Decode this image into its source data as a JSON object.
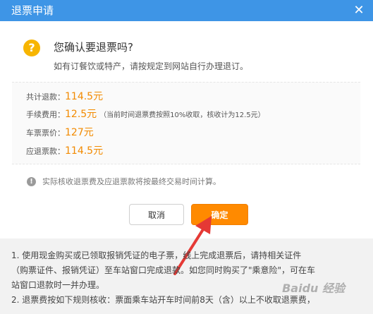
{
  "dialog": {
    "title": "退票申请",
    "close_symbol": "✕",
    "question_symbol": "?",
    "confirm_title": "您确认要退票吗?",
    "confirm_subtitle": "如有订餐饮或特产，请按规定到网站自行办理退订。",
    "summary": {
      "total_label": "共计退款：",
      "total_value": "114.5元",
      "fee_label": "手续费用：",
      "fee_value": "12.5元",
      "fee_note": "（当前时间退票费按照10%收取，核收计为12.5元）",
      "price_label": "车票票价：",
      "price_value": "127元",
      "refund_label": "应退票款：",
      "refund_value": "114.5元"
    },
    "notice_symbol": "!",
    "notice_text": "实际核收退票费及应退票款将按最终交易时间计算。",
    "cancel_label": "取消",
    "confirm_label": "确定"
  },
  "rules": {
    "line1": "1. 使用现金购买或已领取报销凭证的电子票，线上完成退票后，请持相关证件",
    "line2": "（购票证件、报销凭证）至车站窗口完成退款。如您同时购买了\"乘意险\"，可在车",
    "line3": "站窗口退款时一并办理。",
    "line4": "2. 退票费按如下规则核收：票面乘车站开车时间前8天（含）以上不收取退票费，"
  },
  "watermark_text": "Baidu 经验",
  "colors": {
    "title_bar": "#3e95e6",
    "accent_orange": "#ff8a00",
    "value_orange": "#f28a00",
    "question_yellow": "#f7b500",
    "arrow_red": "#e53935"
  },
  "icons": {
    "close": "close-icon",
    "question": "question-icon",
    "notice": "info-icon",
    "arrow": "arrow-annotation-icon"
  }
}
